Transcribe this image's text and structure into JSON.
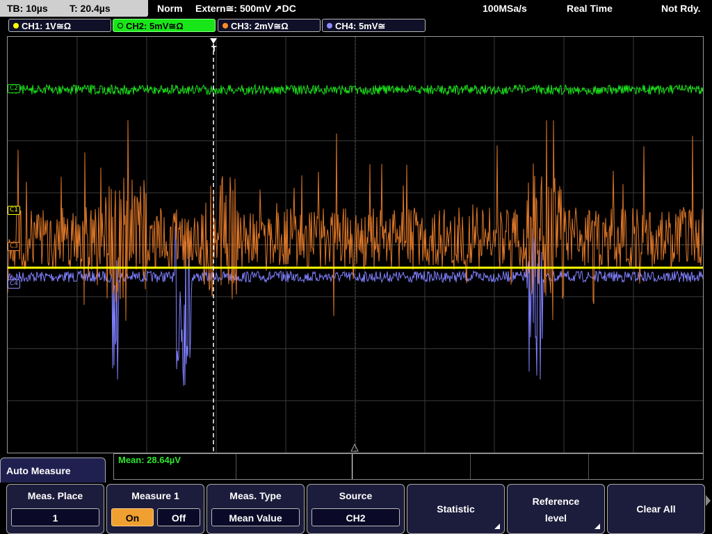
{
  "status": {
    "timebase": "TB: 10µs",
    "trigger_time": "T: 20.4µs",
    "mode": "Norm",
    "trigger_source": "Extern≅: 500mV ↗DC",
    "sample_rate": "100MSa/s",
    "acq_mode": "Real Time",
    "ready_state": "Not Rdy."
  },
  "channels": [
    {
      "label": "CH1: 1V≅Ω",
      "color": "#ffff00"
    },
    {
      "label": "CH2: 5mV≅Ω",
      "color": "#19e619"
    },
    {
      "label": "CH3: 2mV≅Ω",
      "color": "#ff8c28"
    },
    {
      "label": "CH4: 5mV≅",
      "color": "#8c8cff"
    }
  ],
  "markers": {
    "c1": "C1",
    "c2": "C2",
    "c3": "C3",
    "c4": "C4",
    "trigger": "T"
  },
  "measurement": {
    "mean": "Mean: 28.64µV"
  },
  "menu": {
    "title": "Auto Measure",
    "meas_place": {
      "title": "Meas. Place",
      "value": "1"
    },
    "measure1": {
      "title": "Measure 1",
      "on": "On",
      "off": "Off"
    },
    "meas_type": {
      "title": "Meas. Type",
      "value": "Mean Value"
    },
    "source": {
      "title": "Source",
      "value": "CH2"
    },
    "statistic": {
      "title": "Statistic"
    },
    "reference": {
      "title_line1": "Reference",
      "title_line2": "level"
    },
    "clear_all": {
      "title": "Clear All"
    }
  },
  "colors": {
    "ch1": "#ffff00",
    "ch2": "#19e619",
    "ch3": "#e07828",
    "ch4": "#8080ff",
    "grid": "#3a3a3a"
  }
}
